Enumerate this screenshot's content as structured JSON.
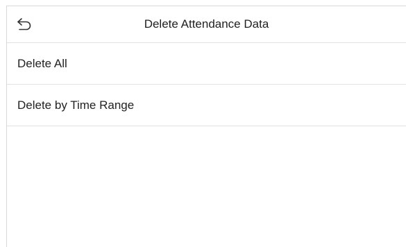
{
  "header": {
    "title": "Delete Attendance Data",
    "back_icon": "undo-arrow-icon"
  },
  "menu": {
    "items": [
      {
        "label": "Delete All"
      },
      {
        "label": "Delete by Time Range"
      }
    ]
  }
}
